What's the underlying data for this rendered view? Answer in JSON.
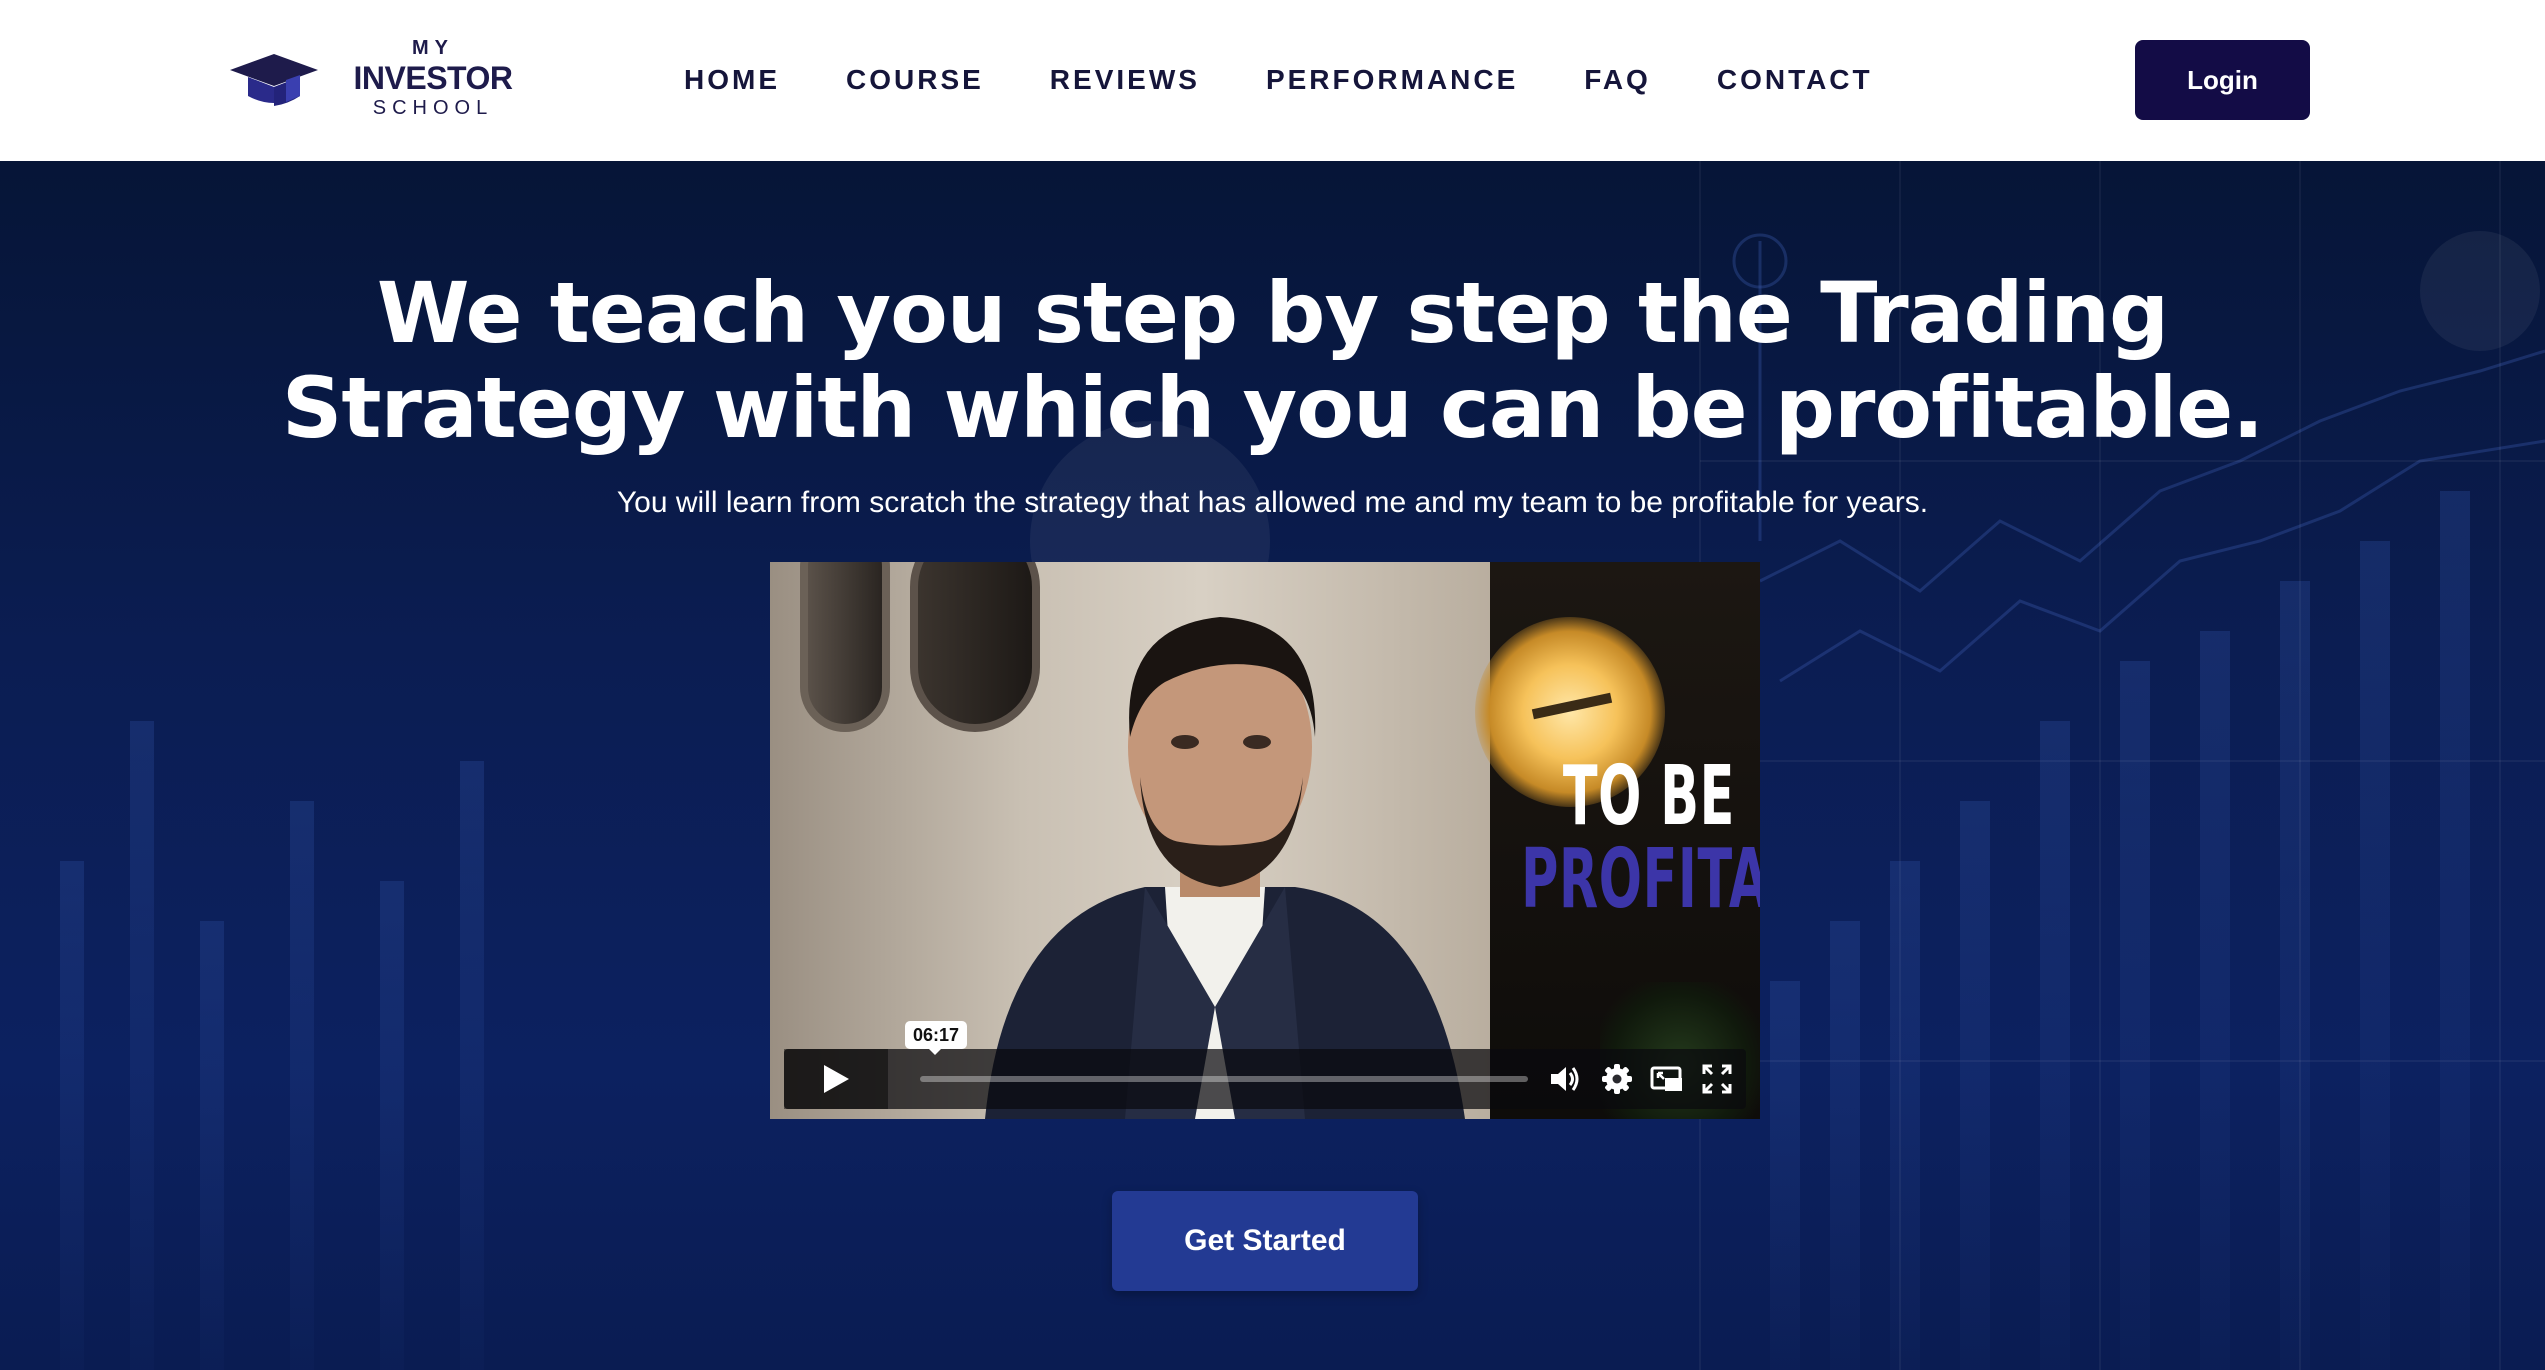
{
  "brand": {
    "line1": "MY",
    "line2": "INVESTOR",
    "line3": "SCHOOL",
    "logo_icon": "graduation-cap-icon",
    "color": "#1e1b4b"
  },
  "nav": {
    "items": [
      {
        "label": "HOME"
      },
      {
        "label": "COURSE"
      },
      {
        "label": "REVIEWS"
      },
      {
        "label": "PERFORMANCE"
      },
      {
        "label": "FAQ"
      },
      {
        "label": "CONTACT"
      }
    ]
  },
  "header": {
    "login_label": "Login",
    "login_color": "#130c46"
  },
  "hero": {
    "headline": "We teach you step by step the Trading Strategy with which you can be profitable.",
    "subheadline": "You will learn from scratch the strategy that has allowed me and my team to be profitable for years.",
    "cta_label": "Get Started",
    "cta_color": "#233a93",
    "background_color": "#0b1d52"
  },
  "video": {
    "overlay_line1": "TO BE",
    "overlay_line2": "PROFITABLE",
    "overlay_accent": "#3c35a8",
    "duration": "06:17",
    "progress": 0,
    "controls": [
      "play-icon",
      "volume-icon",
      "settings-icon",
      "picture-in-picture-icon",
      "fullscreen-icon"
    ]
  }
}
